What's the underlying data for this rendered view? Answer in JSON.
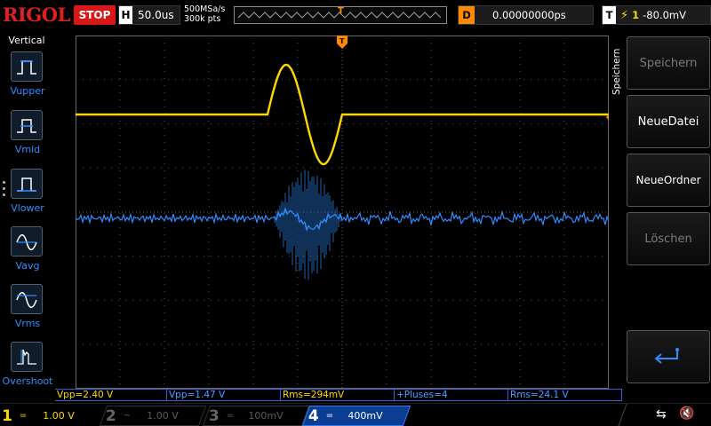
{
  "topbar": {
    "brand": "RIGOL",
    "run_state": "STOP",
    "timebase_label": "H",
    "timebase_value": "50.0us",
    "sample_rate": "500MSa/s",
    "memory_depth": "300k pts",
    "trigger_marker": "T",
    "delay_label": "D",
    "delay_value": "0.00000000ps",
    "trigger_label": "T",
    "trigger_channel": "1",
    "trigger_level": "-80.0mV"
  },
  "left_panel": {
    "title": "Vertical",
    "items": [
      {
        "label": "Vupper",
        "icon": "vupper-icon"
      },
      {
        "label": "Vmid",
        "icon": "vmid-icon"
      },
      {
        "label": "Vlower",
        "icon": "vlower-icon"
      },
      {
        "label": "Vavg",
        "icon": "vavg-icon"
      },
      {
        "label": "Vrms",
        "icon": "vrms-icon"
      },
      {
        "label": "Overshoot",
        "icon": "overshoot-icon"
      }
    ]
  },
  "waveform": {
    "ch1_marker": "1",
    "ch4_marker": "4",
    "trigger_marker": "T",
    "ch1_color": "#ffd700",
    "ch4_color": "#2f8cff",
    "trigger_color": "#ff8a00"
  },
  "right_panel": {
    "title": "Speichern",
    "buttons": [
      {
        "label": "Speichern",
        "enabled": false
      },
      {
        "label": "NeueDatei",
        "enabled": true
      },
      {
        "label": "NeueOrdner",
        "enabled": true
      },
      {
        "label": "Löschen",
        "enabled": false
      },
      {
        "label": "",
        "enabled": true,
        "icon": "enter-return-icon"
      }
    ]
  },
  "measurements": [
    {
      "text": "Vpp=2.40 V",
      "color": "yellow"
    },
    {
      "text": "Vpp=1.47 V",
      "color": "blue"
    },
    {
      "text": "Rms=294mV",
      "color": "yellow"
    },
    {
      "text": "+Pluses=4",
      "color": "blue"
    },
    {
      "text": "Rms=24.1 V",
      "color": "blue"
    }
  ],
  "channels": [
    {
      "num": "1",
      "coupling": "=",
      "scale": "1.00 V",
      "active": true
    },
    {
      "num": "2",
      "coupling": "~",
      "scale": "1.00 V",
      "active": false
    },
    {
      "num": "3",
      "coupling": "=",
      "scale": "100mV",
      "active": false
    },
    {
      "num": "4",
      "coupling": "=",
      "scale": "400mV",
      "active": true
    }
  ]
}
